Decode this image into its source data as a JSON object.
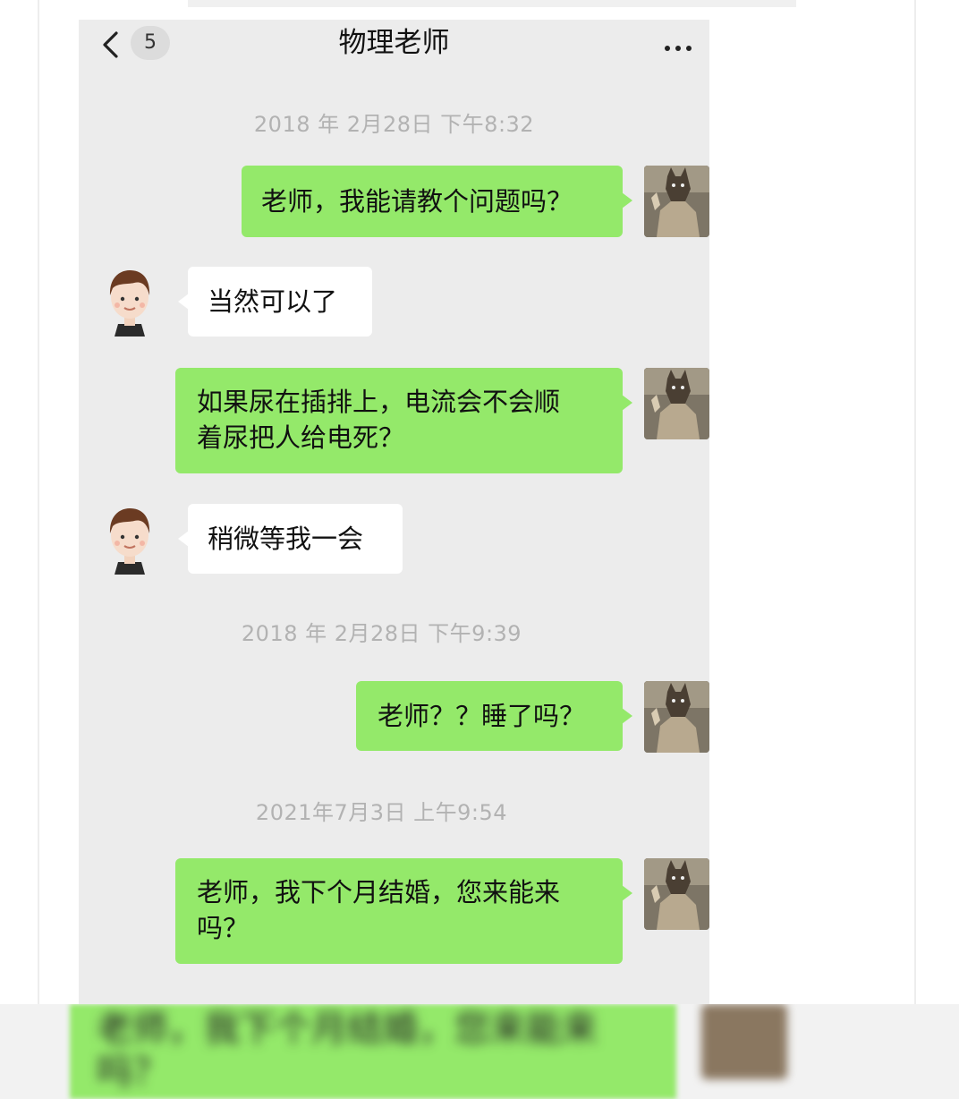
{
  "navbar": {
    "unread_count": "5",
    "title": "物理老师"
  },
  "messages": [
    {
      "type": "timestamp",
      "text": "2018 年 2月28日  下午8:32"
    },
    {
      "type": "me",
      "text": "老师，我能请教个问题吗？"
    },
    {
      "type": "them",
      "text": "当然可以了"
    },
    {
      "type": "me",
      "text": "如果尿在插排上，电流会不会顺\n着尿把人给电死？"
    },
    {
      "type": "them",
      "text": "稍微等我一会"
    },
    {
      "type": "timestamp",
      "text": "2018 年 2月28日  下午9:39"
    },
    {
      "type": "me",
      "text": "老师？？睡了吗？"
    },
    {
      "type": "timestamp",
      "text": "2021年7月3日  上午9:54"
    },
    {
      "type": "me",
      "text": "老师，我下个月结婚，您来能来\n吗？"
    }
  ],
  "blurred_repeat": {
    "text": "老师，我下个月结婚，您来能来\n吗？"
  },
  "colors": {
    "my_bubble": "#94e96a",
    "their_bubble": "#ffffff",
    "chat_background": "#ececec",
    "timestamp_text": "#b2b2b2"
  },
  "icons": {
    "back": "chevron-left-icon",
    "more": "ellipsis-icon"
  }
}
